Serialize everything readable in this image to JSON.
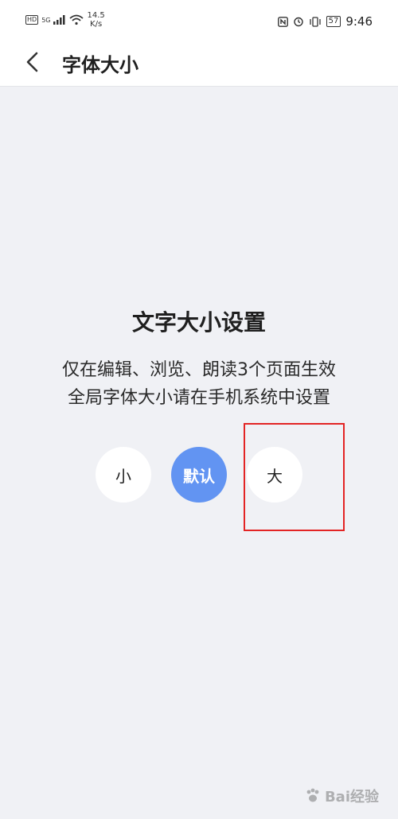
{
  "status_bar": {
    "hd": "HD",
    "signal": "5G",
    "net_speed_value": "14.5",
    "net_speed_unit": "K/s",
    "battery": "57",
    "time": "9:46"
  },
  "app_bar": {
    "title": "字体大小"
  },
  "main": {
    "heading": "文字大小设置",
    "desc_line1": "仅在编辑、浏览、朗读3个页面生效",
    "desc_line2": "全局字体大小请在手机系统中设置",
    "options": [
      {
        "label": "小"
      },
      {
        "label": "默认",
        "selected": true
      },
      {
        "label": "大"
      }
    ]
  },
  "watermark": {
    "text": "Bai经验"
  },
  "colors": {
    "accent": "#6294f2",
    "highlight": "#e32424",
    "background": "#f0f1f5"
  }
}
